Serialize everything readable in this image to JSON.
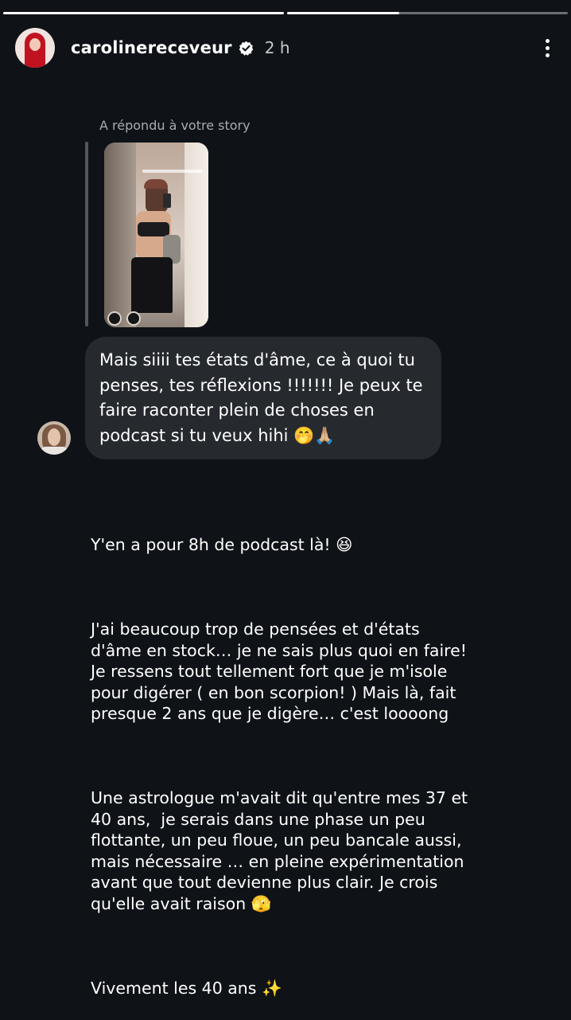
{
  "story": {
    "progress": [
      {
        "fill": 1.0
      },
      {
        "fill": 0.4
      }
    ]
  },
  "header": {
    "username": "carolinereceveur",
    "verified": true,
    "time": "2 h"
  },
  "reply": {
    "label": "A répondu à votre story"
  },
  "message": {
    "text": "Mais siiii tes états d'âme, ce à quoi tu penses, tes réflexions !!!!!!! Je peux te faire raconter plein de choses en podcast si tu veux hihi 🤭🙏🏼"
  },
  "story_text": {
    "paragraphs": [
      "Y'en a pour 8h de podcast là! 😆",
      "J'ai beaucoup trop de pensées et d'états d'âme en stock… je ne sais plus quoi en faire! Je ressens tout tellement fort que je m'isole pour digérer ( en bon scorpion! ) Mais là, fait presque 2 ans que je digère… c'est loooong",
      "Une astrologue m'avait dit qu'entre mes 37 et 40 ans,  je serais dans une phase un peu flottante, un peu floue, un peu bancale aussi, mais nécessaire … en pleine expérimentation avant que tout devienne plus clair. Je crois qu'elle avait raison 🫣",
      "Vivement les 40 ans ✨"
    ]
  },
  "colors": {
    "background": "#0f1317",
    "bubble": "#262a2e",
    "muted_text": "#a8abb0"
  },
  "icons": {
    "verified": "verified-badge-icon",
    "more": "more-vertical-icon"
  }
}
